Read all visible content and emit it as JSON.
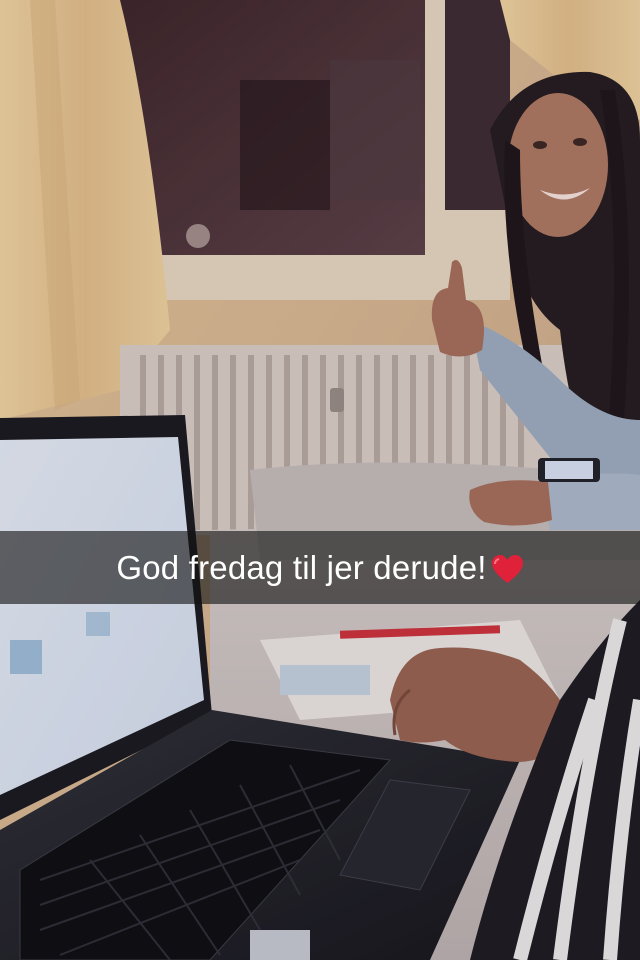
{
  "caption": {
    "text": "God fredag til jer derude!",
    "emoji": "red-heart-icon"
  },
  "colors": {
    "caption_bar": "#141414",
    "caption_text": "#ffffff",
    "heart": "#e0213a"
  }
}
